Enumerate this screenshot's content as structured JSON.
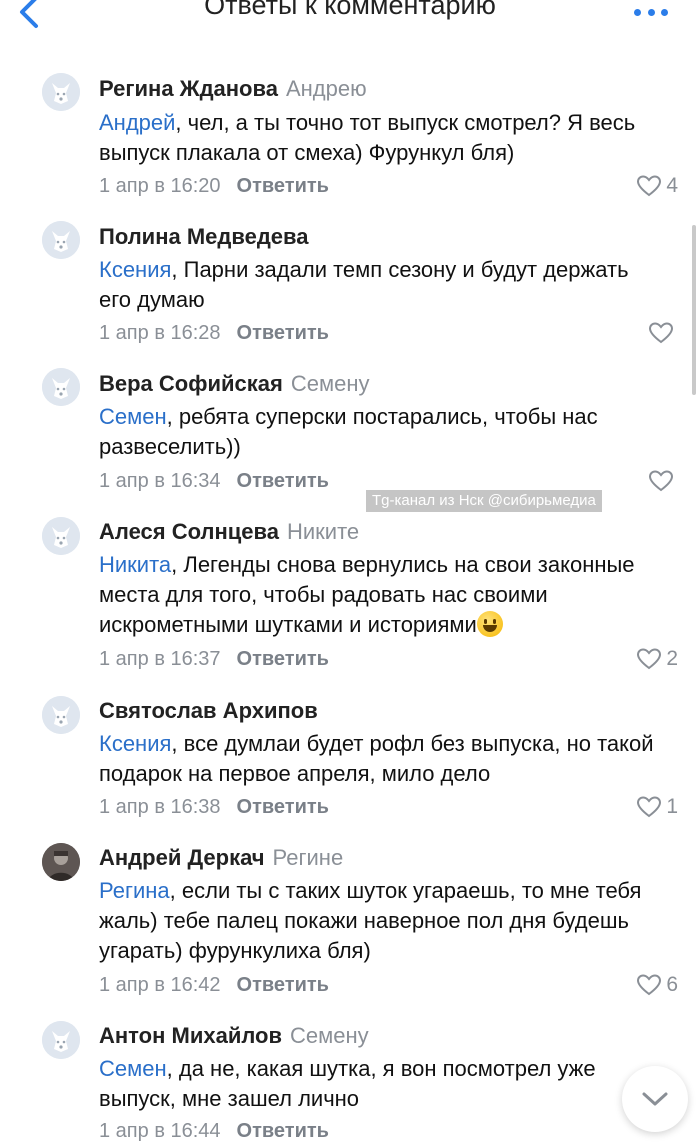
{
  "header": {
    "title": "Ответы к комментарию",
    "back_icon": "chevron-left-icon",
    "more_icon": "more-horizontal-icon",
    "accent_color": "#2b7de9"
  },
  "reply_label": "Ответить",
  "comments": [
    {
      "author": "Регина Жданова",
      "reply_to": "Андрею",
      "mention": "Андрей",
      "text": ", чел, а ты точно тот выпуск смотрел? Я весь выпуск плакала от смеха) Фурункул бля)",
      "time": "1 апр в 16:20",
      "likes": "4"
    },
    {
      "author": "Полина Медведева",
      "reply_to": "",
      "mention": "Ксения",
      "text": ", Парни задали темп сезону и будут держать его думаю",
      "time": "1 апр в 16:28",
      "likes": ""
    },
    {
      "author": "Вера Софийская",
      "reply_to": "Семену",
      "mention": "Семен",
      "text": ", ребята суперски постарались, чтобы нас развеселить))",
      "time": "1 апр в 16:34",
      "likes": ""
    },
    {
      "author": "Алеся Солнцева",
      "reply_to": "Никите",
      "mention": "Никита",
      "text": ", Легенды снова вернулись на свои законные места для того, чтобы радовать нас своими искрометными шутками и историями",
      "time": "1 апр в 16:37",
      "likes": "2",
      "emoji": "grinning-face-emoji"
    },
    {
      "author": "Святослав Архипов",
      "reply_to": "",
      "mention": "Ксения",
      "text": ", все думлаи будет рофл без выпуска, но такой подарок на первое апреля, мило дело",
      "time": "1 апр в 16:38",
      "likes": "1"
    },
    {
      "author": "Андрей Деркач",
      "reply_to": "Регине",
      "mention": "Регина",
      "text": ", если ты с таких шуток угараешь, то мне тебя жаль) тебе палец покажи наверное пол дня будешь угарать) фурункулиха бля)",
      "time": "1 апр в 16:42",
      "likes": "6"
    },
    {
      "author": "Антон Михайлов",
      "reply_to": "Семену",
      "mention": "Семен",
      "text": ", да не, какая шутка, я вон посмотрел уже выпуск, мне зашел лично",
      "time": "1 апр в 16:44",
      "likes": ""
    }
  ],
  "watermark": "Tg-канал из Нск @сибирьмедиа",
  "colors": {
    "mention": "#2a6fc9",
    "secondary_text": "#8a8f96",
    "avatar_bg": "#dfe6ef"
  }
}
